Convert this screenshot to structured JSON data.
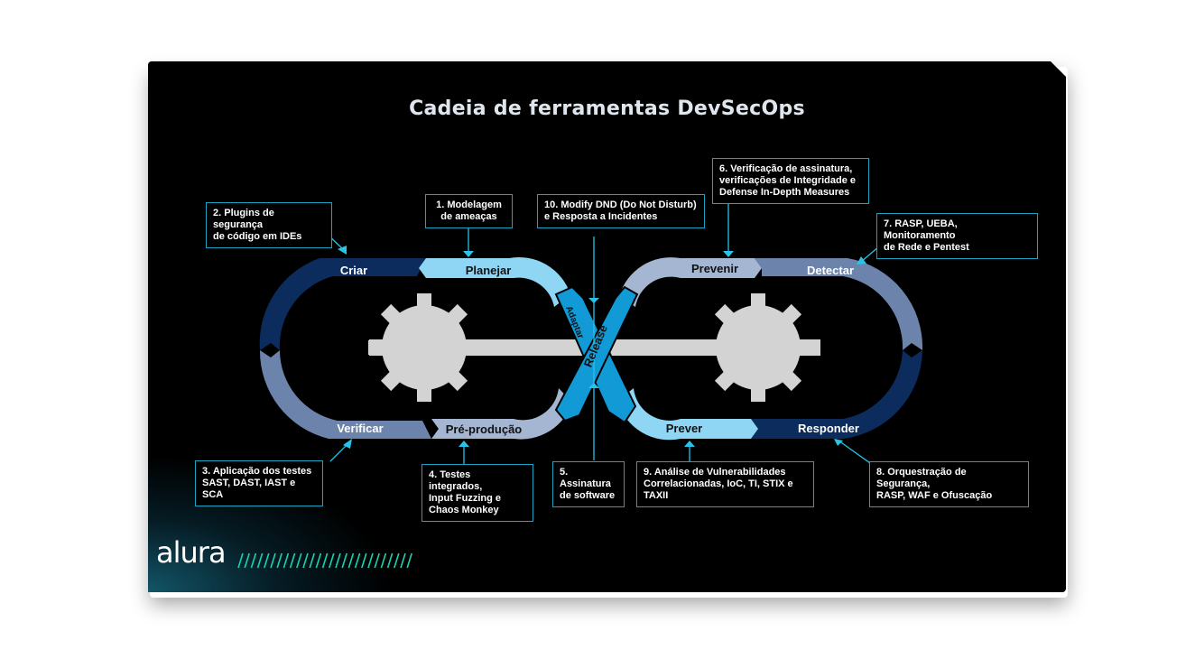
{
  "title": "Cadeia de ferramentas DevSecOps",
  "brand": {
    "name": "alura",
    "accent": "#19d3b0"
  },
  "colors": {
    "dark_navy": "#0b2c5c",
    "slate_blue": "#6c84ab",
    "light_slate": "#a5b6d2",
    "sky_blue": "#8fd6f5",
    "bright_blue": "#129ad6",
    "gear_gray": "#d3d3d3",
    "callout_border": "#1aa4c4",
    "callout_arrow": "#27c4e8"
  },
  "stages": {
    "criar": "Criar",
    "planejar": "Planejar",
    "adaptar": "Adaptar",
    "release": "Release",
    "prevenir": "Prevenir",
    "detectar": "Detectar",
    "verificar": "Verificar",
    "pre_producao": "Pré-produção",
    "prever": "Prever",
    "responder": "Responder"
  },
  "callouts": [
    {
      "id": "1",
      "text": "1. Modelagem\nde ameaças"
    },
    {
      "id": "2",
      "text": "2. Plugins de segurança\n de código em IDEs"
    },
    {
      "id": "3",
      "text": "3. Aplicação dos testes\n SAST, DAST, IAST e SCA"
    },
    {
      "id": "4",
      "text": "4. Testes integrados,\n  Input Fuzzing e\n  Chaos Monkey"
    },
    {
      "id": "5",
      "text": "5. Assinatura\nde software"
    },
    {
      "id": "6",
      "text": "6. Verificação de assinatura,\nverificações de Integridade e\nDefense In-Depth Measures"
    },
    {
      "id": "7",
      "text": "7. RASP, UEBA, Monitoramento\nde Rede e Pentest"
    },
    {
      "id": "8",
      "text": "8. Orquestração de Segurança,\n RASP, WAF e Ofuscação"
    },
    {
      "id": "9",
      "text": "9. Análise de Vulnerabilidades\n Correlacionadas, IoC, TI, STIX e TAXII"
    },
    {
      "id": "10",
      "text": "10. Modify DND (Do Not Disturb)\ne Resposta a Incidentes"
    }
  ]
}
